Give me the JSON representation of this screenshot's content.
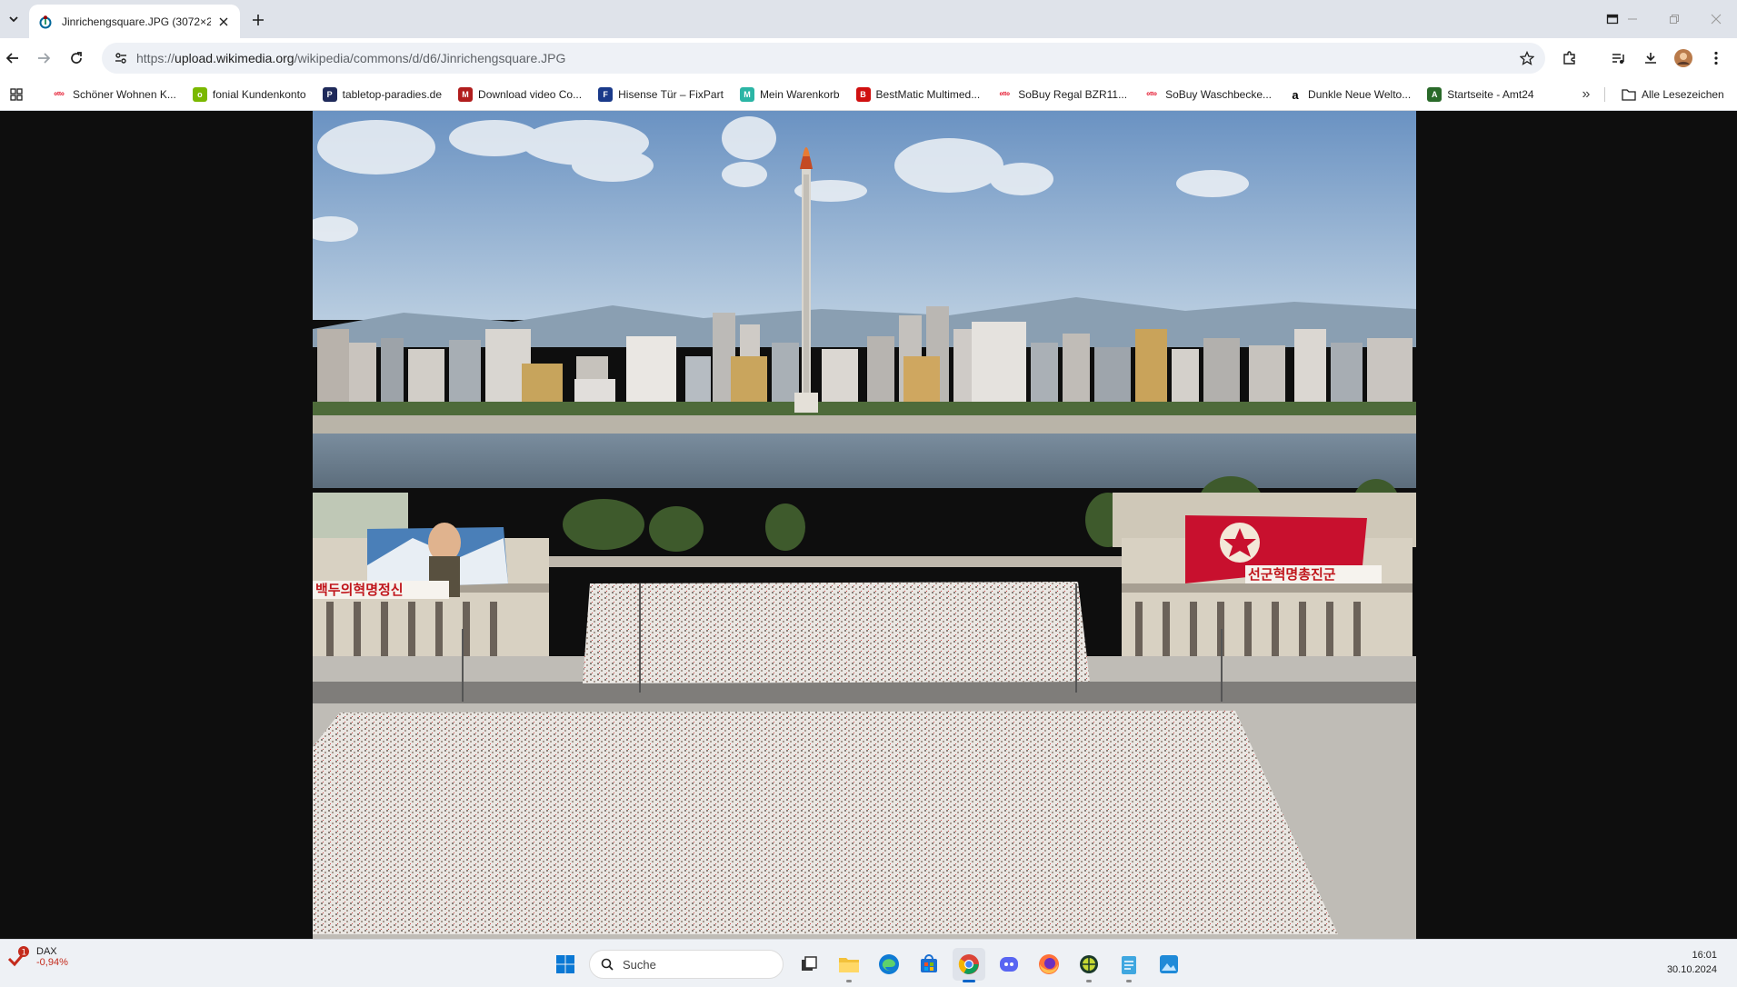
{
  "tab": {
    "title": "Jinrichengsquare.JPG (3072×23"
  },
  "address": {
    "scheme": "https://",
    "host": "upload.wikimedia.org",
    "path": "/wikipedia/commons/d/d6/Jinrichengsquare.JPG"
  },
  "bookmarks": [
    {
      "label": "Schöner Wohnen K...",
      "icon": "otto-icon",
      "color": "#e2001a",
      "glyph": "otto"
    },
    {
      "label": "fonial Kundenkonto",
      "icon": "fonial-icon",
      "color": "#7ab800",
      "glyph": "o"
    },
    {
      "label": "tabletop-paradies.de",
      "icon": "tabletop-icon",
      "color": "#1f2a5a",
      "glyph": "P"
    },
    {
      "label": "Download video Co...",
      "icon": "download-video-icon",
      "color": "#b11d1d",
      "glyph": "M"
    },
    {
      "label": "Hisense Tür – FixPart",
      "icon": "fixpart-icon",
      "color": "#1a3a8a",
      "glyph": "F"
    },
    {
      "label": "Mein Warenkorb",
      "icon": "warenkorb-icon",
      "color": "#2bb5a5",
      "glyph": "M"
    },
    {
      "label": "BestMatic Multimed...",
      "icon": "bestmatic-icon",
      "color": "#d01010",
      "glyph": "B"
    },
    {
      "label": "SoBuy Regal BZR11...",
      "icon": "otto-icon",
      "color": "#e2001a",
      "glyph": "otto"
    },
    {
      "label": "SoBuy Waschbecke...",
      "icon": "otto-icon",
      "color": "#e2001a",
      "glyph": "otto"
    },
    {
      "label": "Dunkle Neue Welto...",
      "icon": "amazon-icon",
      "color": "#ffffff",
      "glyph": "a"
    },
    {
      "label": "Startseite - Amt24",
      "icon": "amt24-icon",
      "color": "#2a6a2a",
      "glyph": "A"
    }
  ],
  "all_bookmarks_label": "Alle Lesezeichen",
  "taskbar": {
    "widget_name": "DAX",
    "widget_value": "-0,94%",
    "widget_badge": "1",
    "search_placeholder": "Suche",
    "time": "16:01",
    "date": "30.10.2024"
  },
  "photo": {
    "banner_left": "백두의혁명정신",
    "banner_right": "선군혁명총진군"
  }
}
